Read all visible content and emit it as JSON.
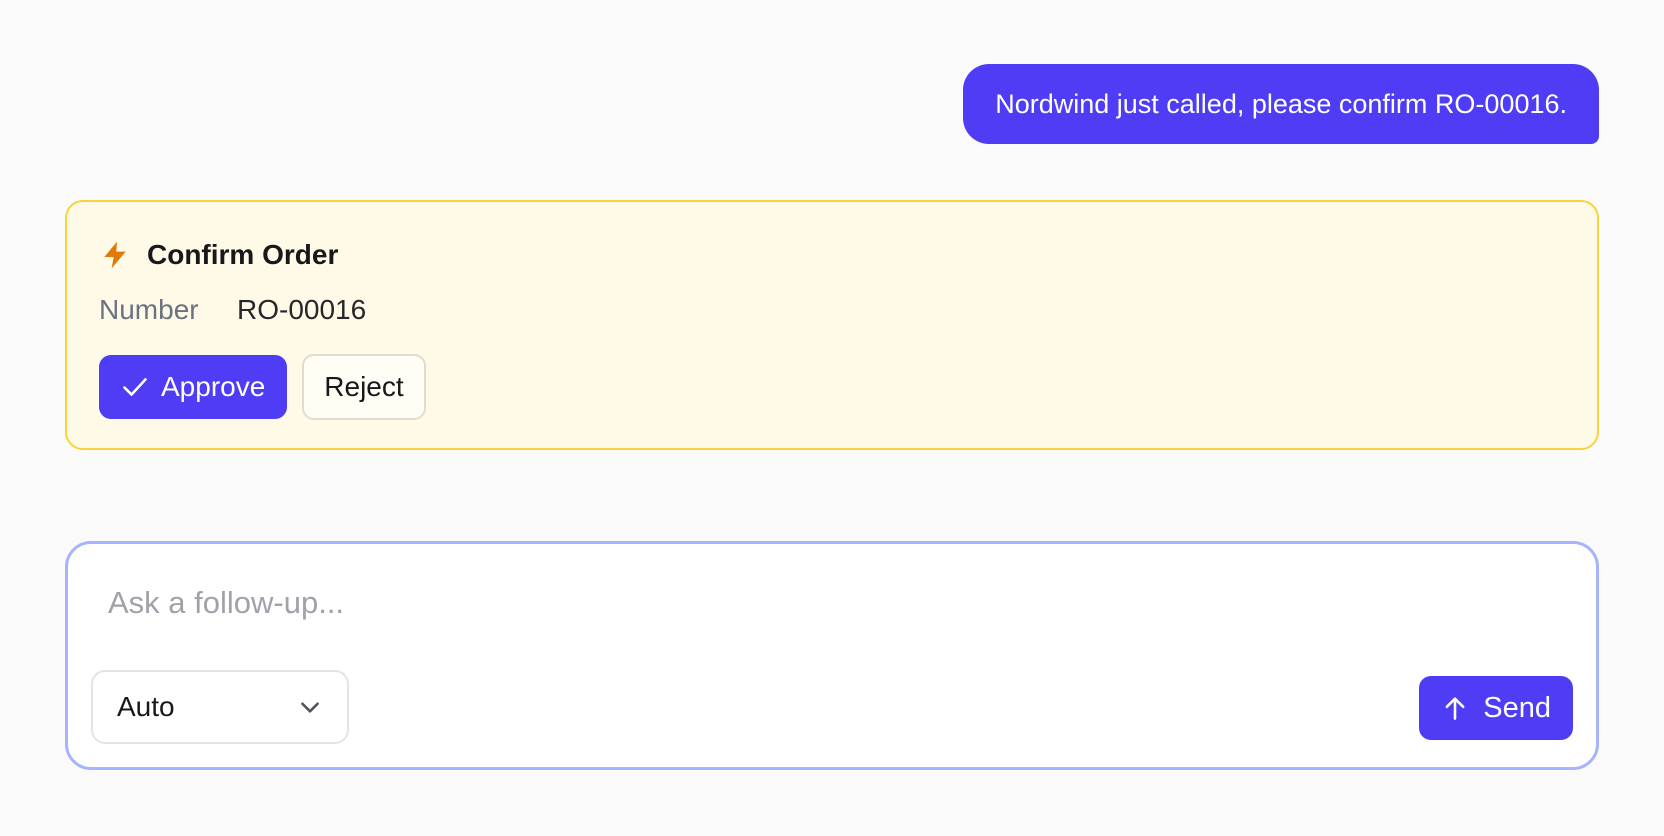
{
  "conversation": {
    "user_message": "Nordwind just called, please confirm RO-00016."
  },
  "action_card": {
    "icon": "bolt-icon",
    "title": "Confirm Order",
    "fields": [
      {
        "label": "Number",
        "value": "RO-00016"
      }
    ],
    "approve_label": "Approve",
    "reject_label": "Reject"
  },
  "composer": {
    "placeholder": "Ask a follow-up...",
    "value": "",
    "mode_selected": "Auto",
    "send_label": "Send"
  },
  "colors": {
    "accent": "#4f3cf5",
    "card_background": "#fffae8",
    "card_border": "#fad33a",
    "bolt": "#e07b0a",
    "composer_border": "#a5b4fc"
  }
}
